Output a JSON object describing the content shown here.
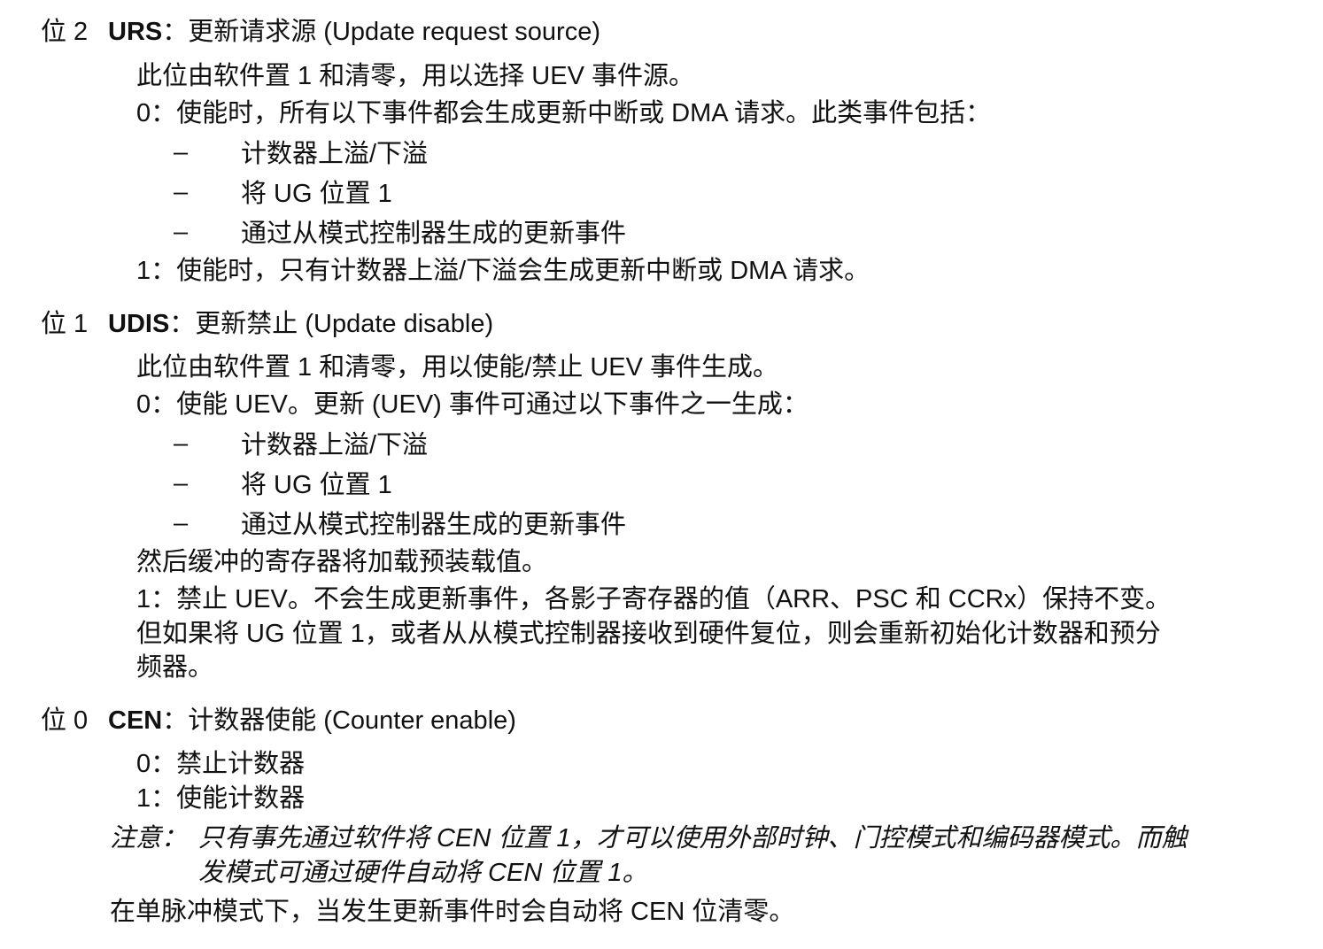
{
  "bit2": {
    "bit_label": "位 2",
    "name": "URS",
    "title": "：更新请求源 (Update request source)",
    "desc": "此位由软件置 1 和清零，用以选择 UEV 事件源。",
    "opt0": "0：使能时，所有以下事件都会生成更新中断或 DMA 请求。此类事件包括：",
    "bullets": [
      "计数器上溢/下溢",
      "将 UG 位置 1",
      "通过从模式控制器生成的更新事件"
    ],
    "opt1": "1：使能时，只有计数器上溢/下溢会生成更新中断或 DMA 请求。"
  },
  "bit1": {
    "bit_label": "位 1",
    "name": "UDIS",
    "title": "：更新禁止 (Update disable)",
    "desc": "此位由软件置 1 和清零，用以使能/禁止 UEV 事件生成。",
    "opt0": "0：使能 UEV。更新 (UEV) 事件可通过以下事件之一生成：",
    "bullets": [
      "计数器上溢/下溢",
      "将 UG 位置 1",
      "通过从模式控制器生成的更新事件"
    ],
    "after": "然后缓冲的寄存器将加载预装载值。",
    "opt1_lines": [
      "1：禁止 UEV。不会生成更新事件，各影子寄存器的值（ARR、PSC 和 CCRx）保持不变。",
      "但如果将 UG 位置 1，或者从从模式控制器接收到硬件复位，则会重新初始化计数器和预分",
      "频器。"
    ]
  },
  "bit0": {
    "bit_label": "位 0",
    "name": "CEN",
    "title": "：计数器使能 (Counter enable)",
    "opt0": "0：禁止计数器",
    "opt1": "1：使能计数器",
    "note_label": "注意：",
    "note_lines": [
      "只有事先通过软件将 CEN 位置 1，才可以使用外部时钟、门控模式和编码器模式。而触",
      "发模式可通过硬件自动将 CEN 位置 1。"
    ],
    "last": "在单脉冲模式下，当发生更新事件时会自动将 CEN 位清零。"
  },
  "dash_symbol": "–"
}
